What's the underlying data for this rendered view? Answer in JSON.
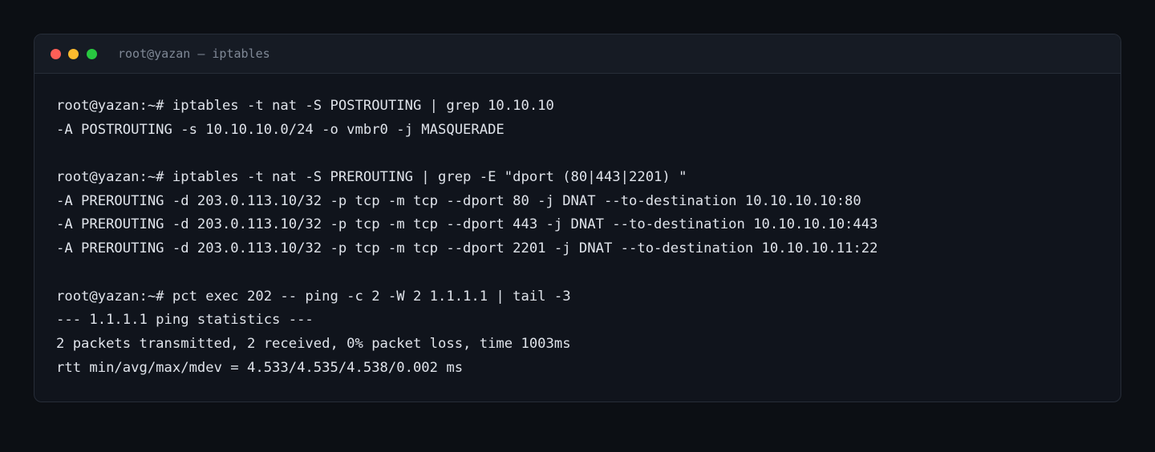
{
  "window": {
    "title": "root@yazan — iptables",
    "controls": {
      "close_color": "#ff5f57",
      "minimize_color": "#febc2e",
      "maximize_color": "#28c840"
    }
  },
  "terminal": {
    "lines": [
      "root@yazan:~# iptables -t nat -S POSTROUTING | grep 10.10.10",
      "-A POSTROUTING -s 10.10.10.0/24 -o vmbr0 -j MASQUERADE",
      "",
      "root@yazan:~# iptables -t nat -S PREROUTING | grep -E \"dport (80|443|2201) \"",
      "-A PREROUTING -d 203.0.113.10/32 -p tcp -m tcp --dport 80 -j DNAT --to-destination 10.10.10.10:80",
      "-A PREROUTING -d 203.0.113.10/32 -p tcp -m tcp --dport 443 -j DNAT --to-destination 10.10.10.10:443",
      "-A PREROUTING -d 203.0.113.10/32 -p tcp -m tcp --dport 2201 -j DNAT --to-destination 10.10.10.11:22",
      "",
      "root@yazan:~# pct exec 202 -- ping -c 2 -W 2 1.1.1.1 | tail -3",
      "--- 1.1.1.1 ping statistics ---",
      "2 packets transmitted, 2 received, 0% packet loss, time 1003ms",
      "rtt min/avg/max/mdev = 4.533/4.535/4.538/0.002 ms"
    ]
  }
}
